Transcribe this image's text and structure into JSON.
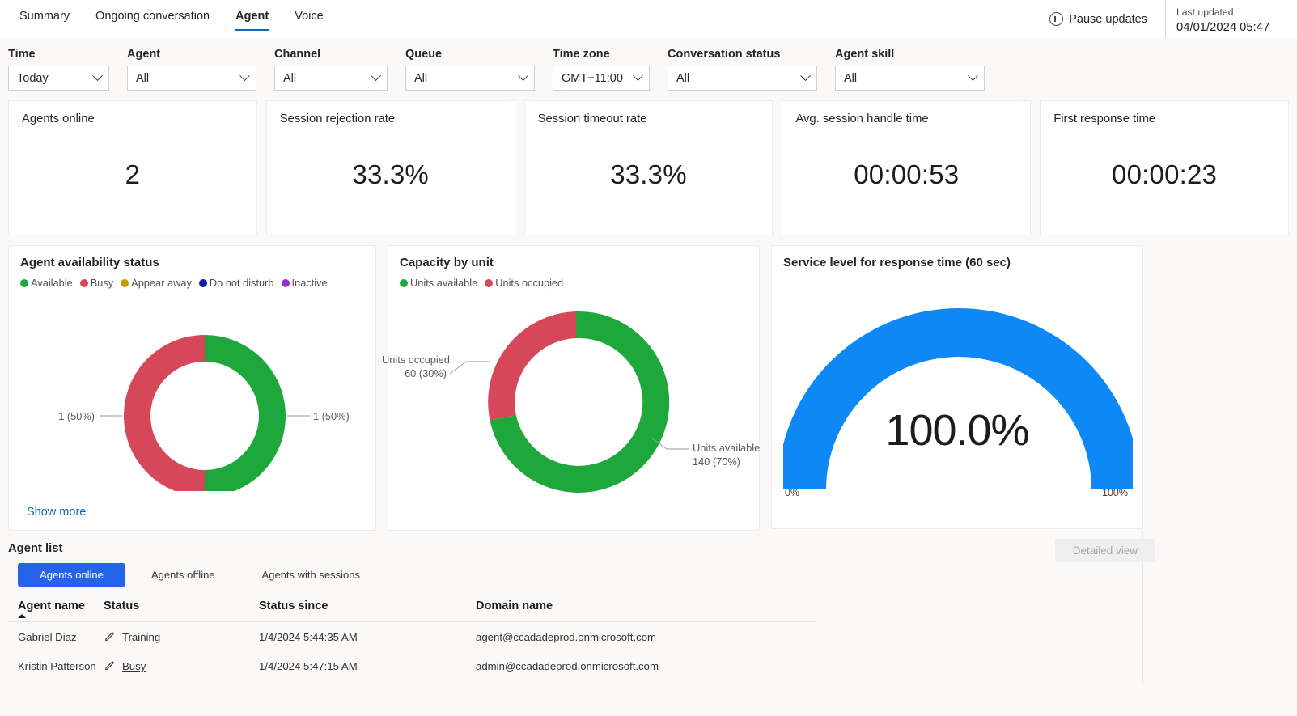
{
  "nav": {
    "tabs": [
      {
        "label": "Summary",
        "active": false
      },
      {
        "label": "Ongoing conversation",
        "active": false
      },
      {
        "label": "Agent",
        "active": true
      },
      {
        "label": "Voice",
        "active": false
      }
    ],
    "pause_label": "Pause updates",
    "pause_icon": "pause-circle-icon",
    "last_updated_label": "Last updated",
    "last_updated_value": "04/01/2024 05:47"
  },
  "filters": [
    {
      "label": "Time",
      "value": "Today",
      "width_class": "w-time",
      "name": "time"
    },
    {
      "label": "Agent",
      "value": "All",
      "width_class": "w-agent",
      "name": "agent"
    },
    {
      "label": "Channel",
      "value": "All",
      "width_class": "w-chan",
      "name": "channel"
    },
    {
      "label": "Queue",
      "value": "All",
      "width_class": "w-queue",
      "name": "queue"
    },
    {
      "label": "Time zone",
      "value": "GMT+11:00",
      "width_class": "w-tz",
      "name": "timezone"
    },
    {
      "label": "Conversation status",
      "value": "All",
      "width_class": "w-convo",
      "name": "conversation-status"
    },
    {
      "label": "Agent skill",
      "value": "All",
      "width_class": "w-skill",
      "name": "agent-skill"
    }
  ],
  "kpis": [
    {
      "title": "Agents online",
      "value": "2"
    },
    {
      "title": "Session rejection rate",
      "value": "33.3%"
    },
    {
      "title": "Session timeout rate",
      "value": "33.3%"
    },
    {
      "title": "Avg. session handle time",
      "value": "00:00:53"
    },
    {
      "title": "First response time",
      "value": "00:00:23"
    }
  ],
  "availability": {
    "title": "Agent availability status",
    "show_more": "Show more",
    "legend": [
      {
        "label": "Available",
        "color": "#1ea83c"
      },
      {
        "label": "Busy",
        "color": "#d6475a"
      },
      {
        "label": "Appear away",
        "color": "#c19c00"
      },
      {
        "label": "Do not disturb",
        "color": "#0b21a8"
      },
      {
        "label": "Inactive",
        "color": "#9333c4"
      }
    ],
    "label_left": "1 (50%)",
    "label_right": "1 (50%)"
  },
  "capacity": {
    "title": "Capacity by unit",
    "legend": [
      {
        "label": "Units available",
        "color": "#1ea83c"
      },
      {
        "label": "Units occupied",
        "color": "#d6475a"
      }
    ],
    "label_occupied_line1": "Units occupied",
    "label_occupied_line2": "60 (30%)",
    "label_available_line1": "Units available",
    "label_available_line2": "140 (70%)"
  },
  "service_level": {
    "title": "Service level for response time (60 sec)",
    "value": "100.0%",
    "axis_min": "0%",
    "axis_max": "100%",
    "color": "#0d88f5"
  },
  "agent_list": {
    "title": "Agent list",
    "detailed_view": "Detailed view",
    "pills": [
      {
        "label": "Agents online",
        "active": true
      },
      {
        "label": "Agents offline",
        "active": false
      },
      {
        "label": "Agents with sessions",
        "active": false
      }
    ],
    "columns": [
      "Agent name",
      "Status",
      "Status since",
      "Domain name"
    ],
    "rows": [
      {
        "name": "Gabriel Diaz",
        "status": "Training",
        "since": "1/4/2024 5:44:35 AM",
        "domain": "agent@ccadadeprod.onmicrosoft.com"
      },
      {
        "name": "Kristin Patterson",
        "status": "Busy",
        "since": "1/4/2024 5:47:15 AM",
        "domain": "admin@ccadadeprod.onmicrosoft.com"
      }
    ]
  },
  "chart_data": [
    {
      "type": "pie",
      "title": "Agent availability status",
      "subtype": "donut",
      "categories": [
        "Available",
        "Busy",
        "Appear away",
        "Do not disturb",
        "Inactive"
      ],
      "values": [
        1,
        1,
        0,
        0,
        0
      ],
      "percentages": [
        50,
        50,
        0,
        0,
        0
      ],
      "colors": [
        "#1ea83c",
        "#d6475a",
        "#c19c00",
        "#0b21a8",
        "#9333c4"
      ],
      "data_labels": [
        "1 (50%)",
        "1 (50%)"
      ],
      "legend_position": "top",
      "grid": false
    },
    {
      "type": "pie",
      "title": "Capacity by unit",
      "subtype": "donut",
      "categories": [
        "Units available",
        "Units occupied"
      ],
      "values": [
        140,
        60
      ],
      "percentages": [
        70,
        30
      ],
      "colors": [
        "#1ea83c",
        "#d6475a"
      ],
      "data_labels": [
        "Units available 140 (70%)",
        "Units occupied 60 (30%)"
      ],
      "legend_position": "top",
      "grid": false
    },
    {
      "type": "gauge",
      "title": "Service level for response time (60 sec)",
      "value": 100.0,
      "display_value": "100.0%",
      "ylim": [
        0,
        100
      ],
      "tick_labels": [
        "0%",
        "100%"
      ],
      "color": "#0d88f5",
      "grid": false
    }
  ]
}
